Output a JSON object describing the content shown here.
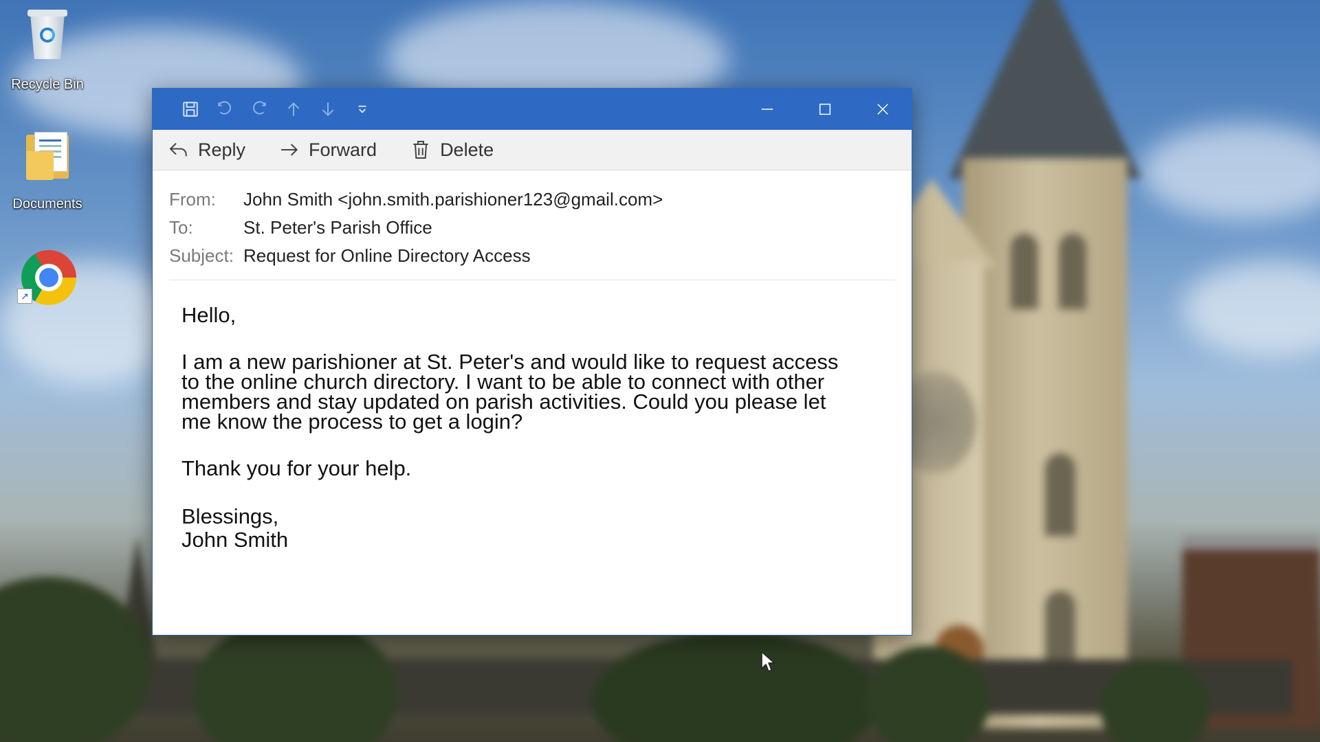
{
  "desktop": {
    "icons": [
      {
        "label": "Recycle Bin",
        "icon": "recycle-bin-icon"
      },
      {
        "label": "Documents",
        "icon": "folder-icon"
      },
      {
        "label": "",
        "icon": "chrome-icon"
      }
    ]
  },
  "window": {
    "quick_access": [
      "save-icon",
      "undo-icon",
      "redo-icon",
      "up-arrow-icon",
      "down-arrow-icon",
      "customize-icon"
    ],
    "controls": [
      "minimize-icon",
      "maximize-icon",
      "close-icon"
    ],
    "toolbar": {
      "reply_label": "Reply",
      "forward_label": "Forward",
      "delete_label": "Delete"
    },
    "headers": {
      "from_label": "From:",
      "from_value": "John Smith <john.smith.parishioner123@gmail.com>",
      "to_label": "To:",
      "to_value": "St. Peter's Parish Office",
      "subject_label": "Subject:",
      "subject_value": "Request for Online Directory Access"
    },
    "body": {
      "greeting": "Hello,",
      "main_lines": [
        "I am a new parishioner at St. Peter's and would like to request access",
        "to the online church directory. I want to be able to connect with other",
        "members and stay updated on parish activities. Could you please let",
        "me know the process to get a login?"
      ],
      "thanks": "Thank you for your help.",
      "closing": "Blessings,",
      "signature": "John Smith"
    }
  },
  "colors": {
    "titlebar": "#2e6ac4",
    "toolbar": "#f1f1f1",
    "label_gray": "#7a7a7a"
  }
}
